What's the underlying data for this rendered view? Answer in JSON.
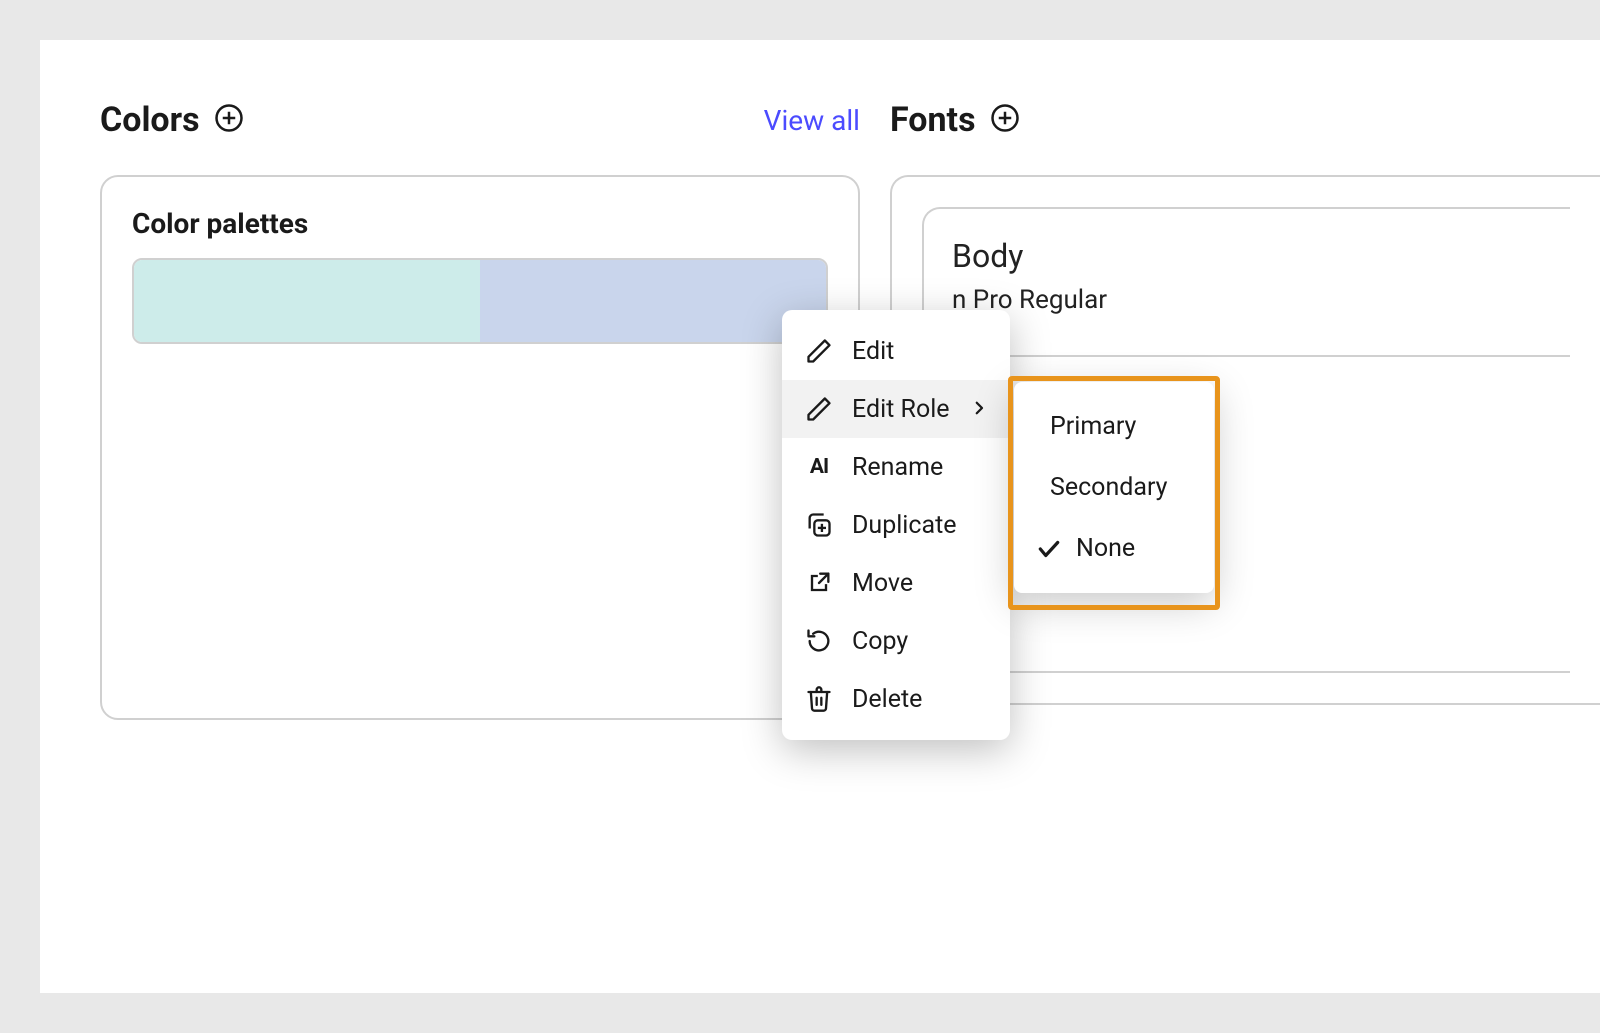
{
  "colors": {
    "title": "Colors",
    "view_all": "View all",
    "card_title": "Color palettes",
    "palette": [
      "#cdecea",
      "#c9d5ec"
    ]
  },
  "fonts": {
    "title": "Fonts",
    "body_label": "Body",
    "font_name_fragment": "n Pro Regular"
  },
  "context_menu": {
    "edit": "Edit",
    "edit_role": "Edit Role",
    "rename": "Rename",
    "duplicate": "Duplicate",
    "move": "Move",
    "copy": "Copy",
    "delete": "Delete"
  },
  "role_submenu": {
    "primary": "Primary",
    "secondary": "Secondary",
    "none": "None",
    "selected": "None"
  },
  "highlight_color": "#e8941c"
}
